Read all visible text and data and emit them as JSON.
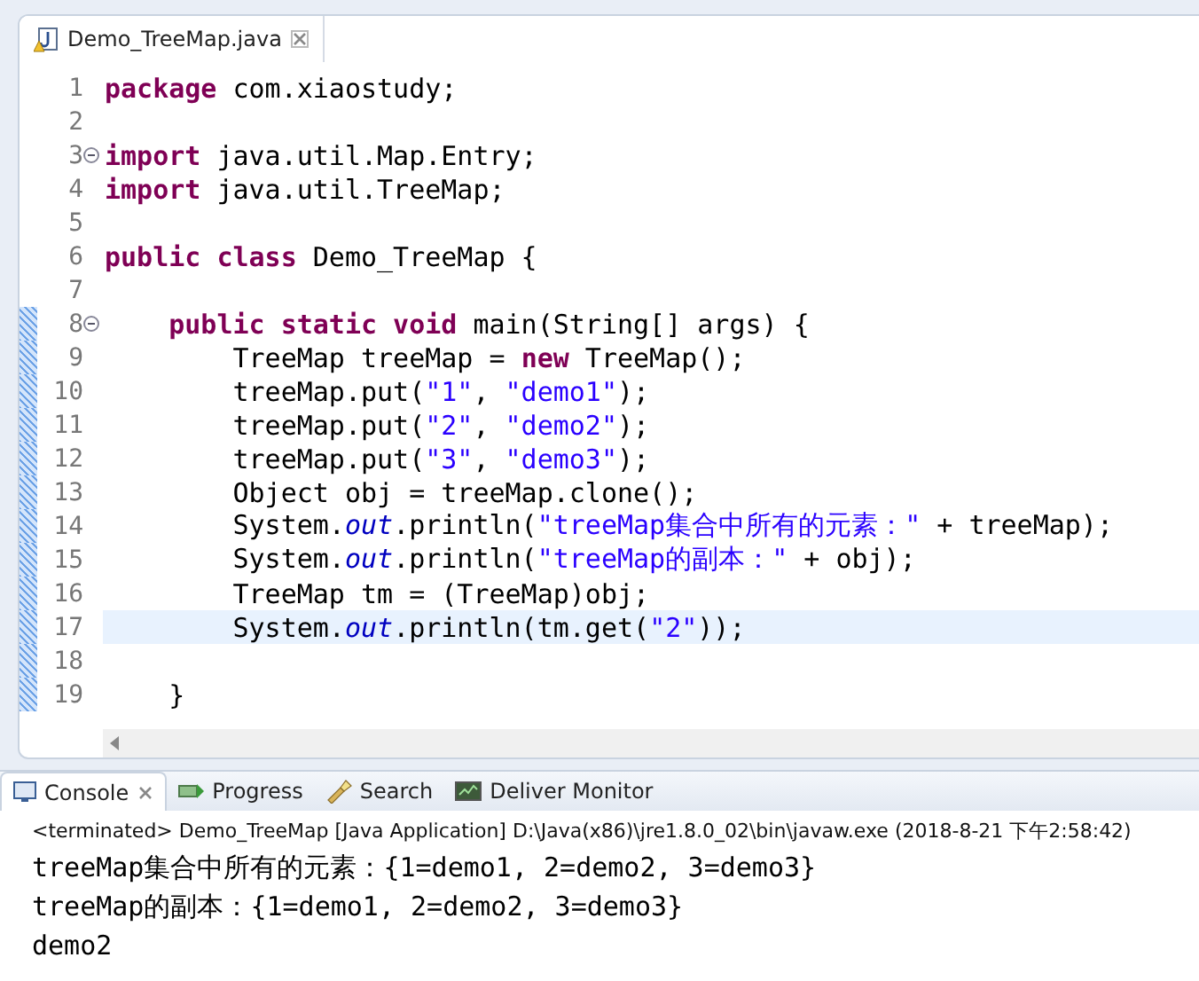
{
  "editor": {
    "tab": {
      "label": "Demo_TreeMap.java",
      "selected": true
    },
    "lines": [
      {
        "number": "1",
        "fold": false,
        "marked": false,
        "current": false,
        "tokens": [
          {
            "kind": "keyword",
            "text": "package"
          },
          {
            "kind": "plain",
            "text": " com.xiaostudy;"
          }
        ]
      },
      {
        "number": "2",
        "fold": false,
        "marked": false,
        "current": false
      },
      {
        "number": "3",
        "fold": true,
        "marked": false,
        "current": false,
        "tokens": [
          {
            "kind": "keyword",
            "text": "import"
          },
          {
            "kind": "plain",
            "text": " java.util.Map.Entry;"
          }
        ]
      },
      {
        "number": "4",
        "fold": false,
        "marked": false,
        "current": false,
        "tokens": [
          {
            "kind": "keyword",
            "text": "import"
          },
          {
            "kind": "plain",
            "text": " java.util.TreeMap;"
          }
        ]
      },
      {
        "number": "5",
        "fold": false,
        "marked": false,
        "current": false
      },
      {
        "number": "6",
        "fold": false,
        "marked": false,
        "current": false,
        "tokens": [
          {
            "kind": "keyword",
            "text": "public"
          },
          {
            "kind": "keyword",
            "text": " class"
          },
          {
            "kind": "plain",
            "text": " Demo_TreeMap {"
          }
        ]
      },
      {
        "number": "7",
        "fold": false,
        "marked": false,
        "current": false
      },
      {
        "number": "8",
        "fold": true,
        "marked": true,
        "current": false,
        "tokens": [
          {
            "kind": "keyword",
            "text": "    public"
          },
          {
            "kind": "keyword",
            "text": " static"
          },
          {
            "kind": "keyword",
            "text": " void"
          },
          {
            "kind": "plain",
            "text": " main(String[] args) {"
          }
        ]
      },
      {
        "number": "9",
        "fold": false,
        "marked": true,
        "current": false,
        "tokens": [
          {
            "kind": "plain",
            "text": "        TreeMap treeMap = "
          },
          {
            "kind": "keyword",
            "text": "new"
          },
          {
            "kind": "plain",
            "text": " TreeMap();"
          }
        ]
      },
      {
        "number": "10",
        "fold": false,
        "marked": true,
        "current": false,
        "tokens": [
          {
            "kind": "plain",
            "text": "        treeMap.put("
          },
          {
            "kind": "string",
            "text": "\"1\""
          },
          {
            "kind": "plain",
            "text": ", "
          },
          {
            "kind": "string",
            "text": "\"demo1\""
          },
          {
            "kind": "plain",
            "text": ");"
          }
        ]
      },
      {
        "number": "11",
        "fold": false,
        "marked": true,
        "current": false,
        "tokens": [
          {
            "kind": "plain",
            "text": "        treeMap.put("
          },
          {
            "kind": "string",
            "text": "\"2\""
          },
          {
            "kind": "plain",
            "text": ", "
          },
          {
            "kind": "string",
            "text": "\"demo2\""
          },
          {
            "kind": "plain",
            "text": ");"
          }
        ]
      },
      {
        "number": "12",
        "fold": false,
        "marked": true,
        "current": false,
        "tokens": [
          {
            "kind": "plain",
            "text": "        treeMap.put("
          },
          {
            "kind": "string",
            "text": "\"3\""
          },
          {
            "kind": "plain",
            "text": ", "
          },
          {
            "kind": "string",
            "text": "\"demo3\""
          },
          {
            "kind": "plain",
            "text": ");"
          }
        ]
      },
      {
        "number": "13",
        "fold": false,
        "marked": true,
        "current": false,
        "tokens": [
          {
            "kind": "plain",
            "text": "        Object obj = treeMap.clone();"
          }
        ]
      },
      {
        "number": "14",
        "fold": false,
        "marked": true,
        "current": false,
        "tokens": [
          {
            "kind": "plain",
            "text": "        System."
          },
          {
            "kind": "field",
            "text": "out"
          },
          {
            "kind": "plain",
            "text": ".println("
          },
          {
            "kind": "string",
            "text": "\"treeMap集合中所有的元素：\""
          },
          {
            "kind": "plain",
            "text": " + treeMap);"
          }
        ]
      },
      {
        "number": "15",
        "fold": false,
        "marked": true,
        "current": false,
        "tokens": [
          {
            "kind": "plain",
            "text": "        System."
          },
          {
            "kind": "field",
            "text": "out"
          },
          {
            "kind": "plain",
            "text": ".println("
          },
          {
            "kind": "string",
            "text": "\"treeMap的副本：\""
          },
          {
            "kind": "plain",
            "text": " + obj);"
          }
        ]
      },
      {
        "number": "16",
        "fold": false,
        "marked": true,
        "current": false,
        "tokens": [
          {
            "kind": "plain",
            "text": "        TreeMap tm = (TreeMap)obj;"
          }
        ]
      },
      {
        "number": "17",
        "fold": false,
        "marked": true,
        "current": true,
        "tokens": [
          {
            "kind": "plain",
            "text": "        System."
          },
          {
            "kind": "field",
            "text": "out"
          },
          {
            "kind": "plain",
            "text": ".println(tm.get("
          },
          {
            "kind": "string",
            "text": "\"2\""
          },
          {
            "kind": "plain",
            "text": "));"
          }
        ]
      },
      {
        "number": "18",
        "fold": false,
        "marked": true,
        "current": false
      },
      {
        "number": "19",
        "fold": false,
        "marked": true,
        "current": false,
        "tokens": [
          {
            "kind": "plain",
            "text": "    }"
          }
        ]
      }
    ]
  },
  "console": {
    "tabs": [
      {
        "label": "Console",
        "kind": "console",
        "selected": true,
        "closable": true
      },
      {
        "label": "Progress",
        "kind": "progress",
        "selected": false,
        "closable": false
      },
      {
        "label": "Search",
        "kind": "search",
        "selected": false,
        "closable": false
      },
      {
        "label": "Deliver Monitor",
        "kind": "monitor",
        "selected": false,
        "closable": false
      }
    ],
    "status": "<terminated> Demo_TreeMap [Java Application] D:\\Java(x86)\\jre1.8.0_02\\bin\\javaw.exe (2018-8-21 下午2:58:42)",
    "output": [
      "treeMap集合中所有的元素：{1=demo1, 2=demo2, 3=demo3}",
      "treeMap的副本：{1=demo1, 2=demo2, 3=demo3}",
      "demo2"
    ]
  }
}
